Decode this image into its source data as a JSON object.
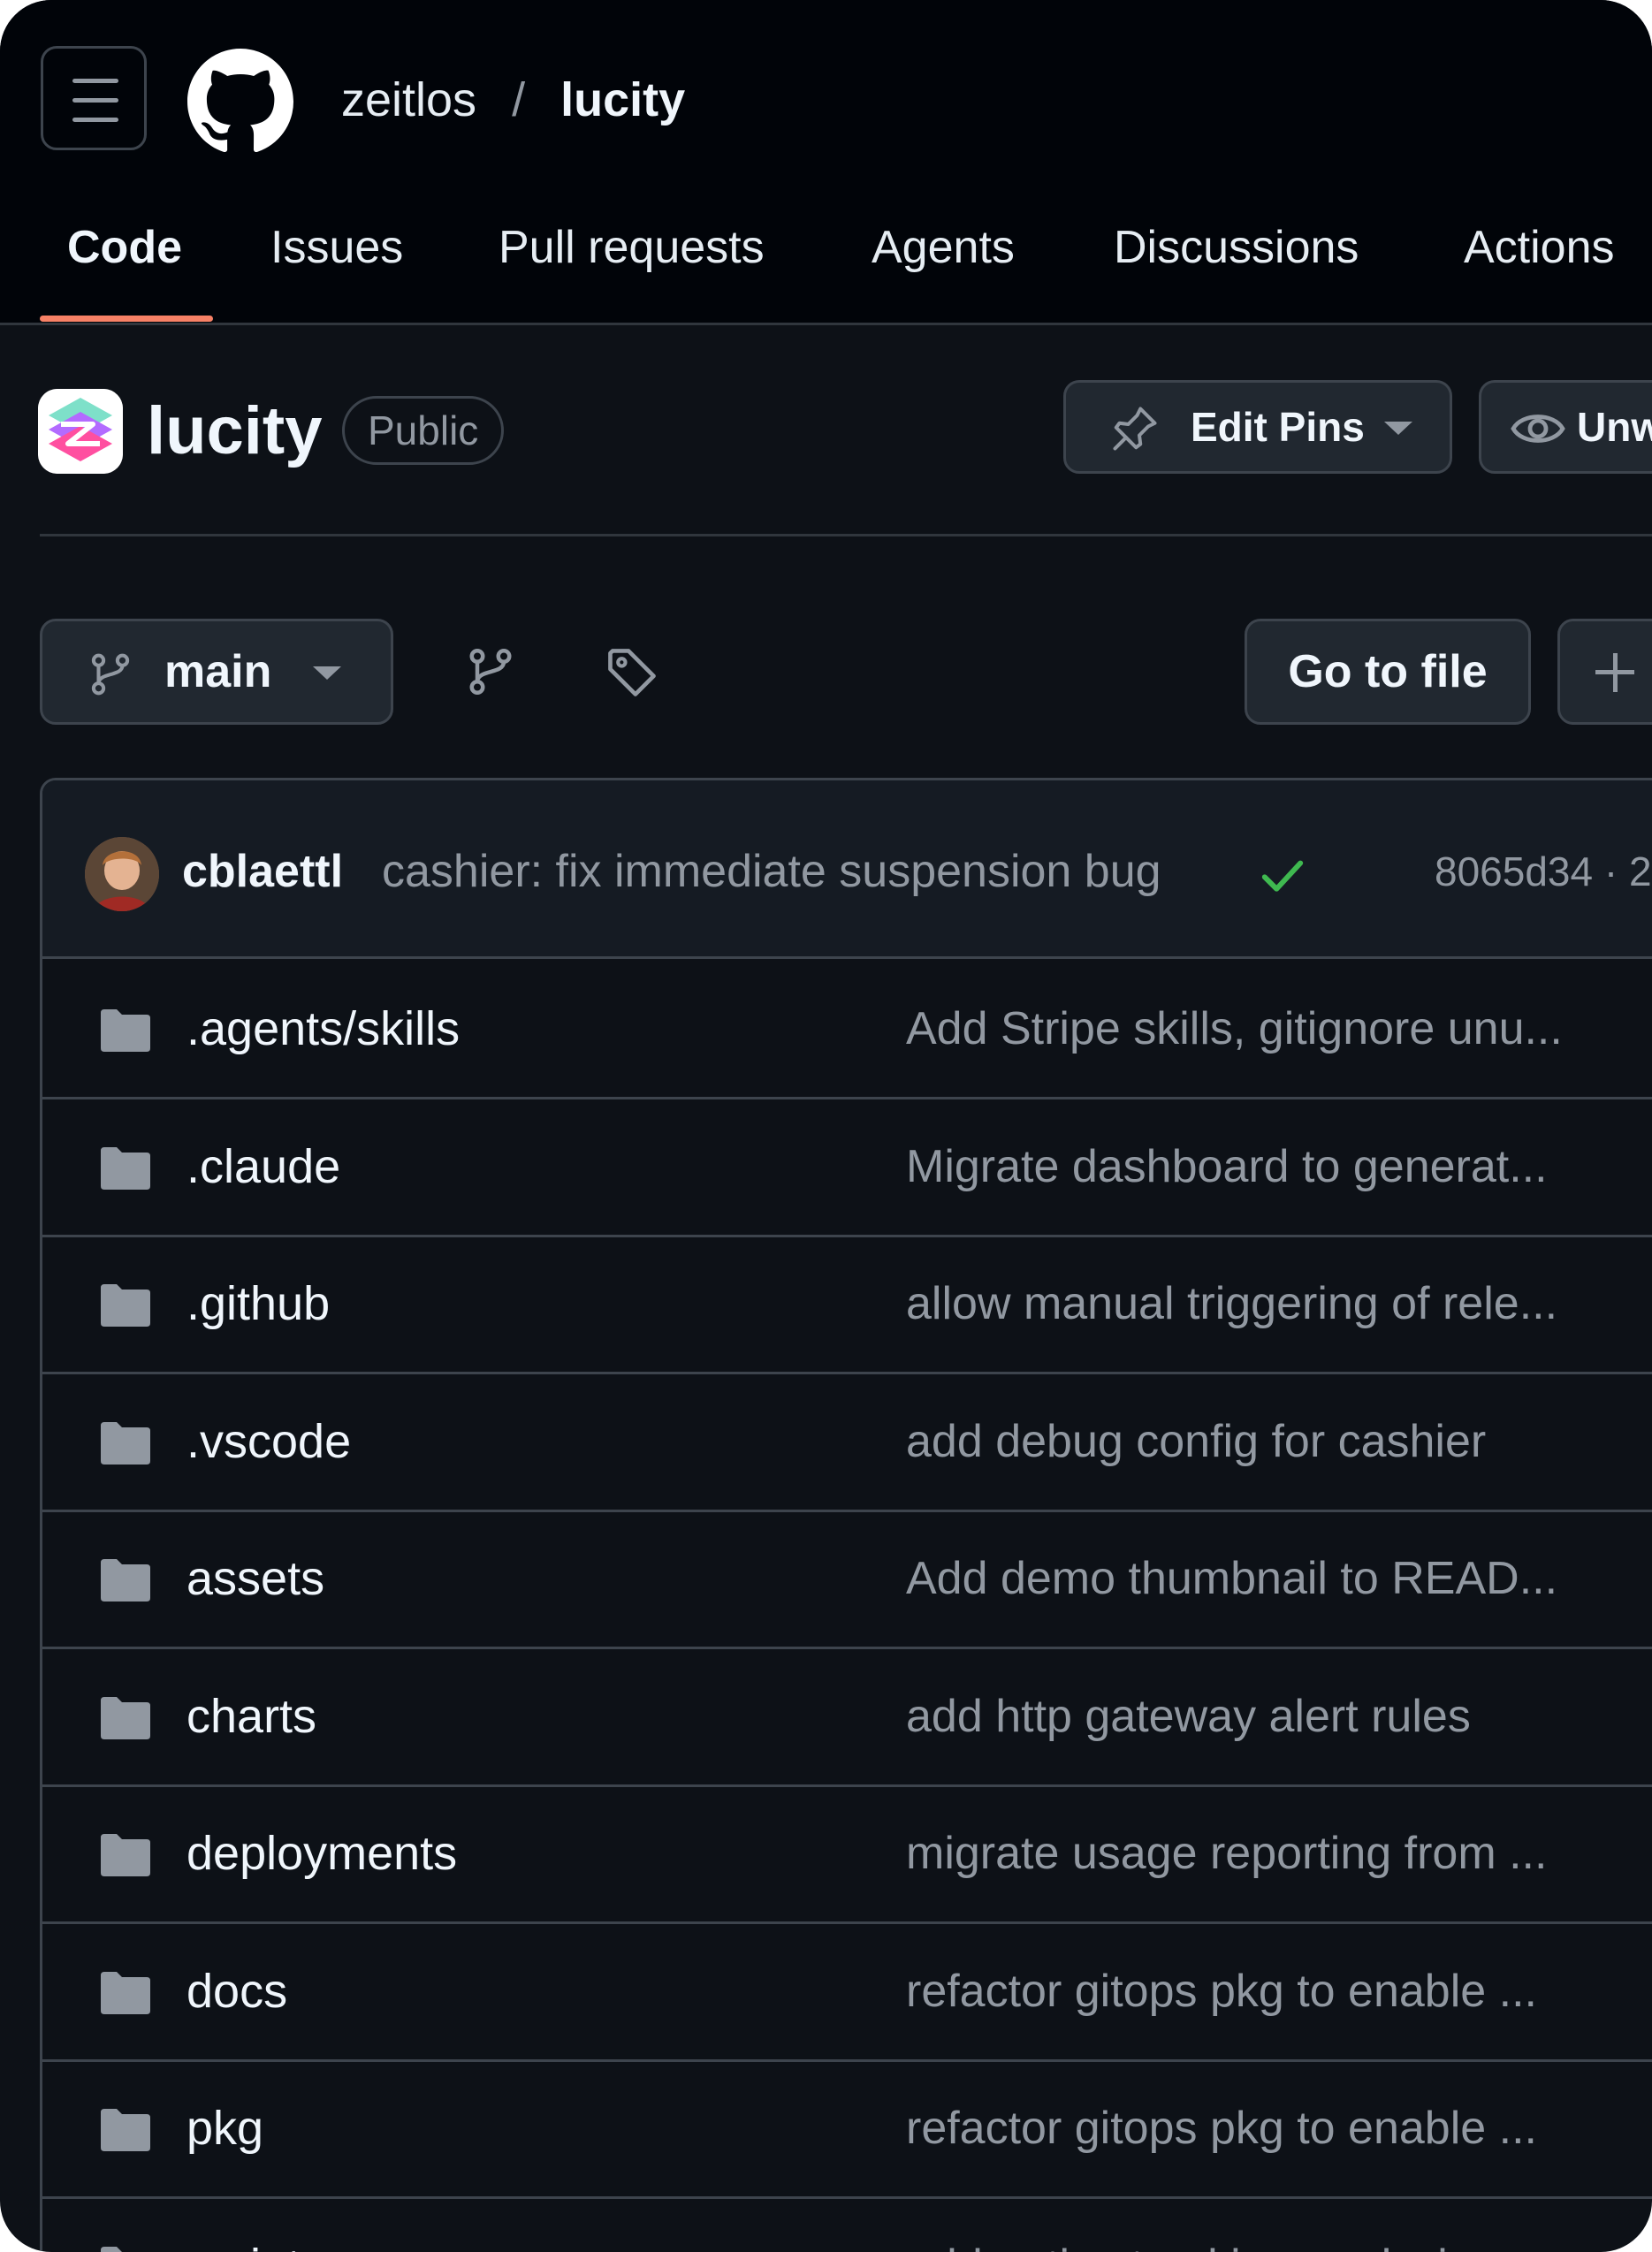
{
  "header": {
    "owner": "zeitlos",
    "separator": "/",
    "repo": "lucity",
    "menu_icon": "hamburger-icon",
    "logo_icon": "github-mark-icon"
  },
  "tabs": [
    {
      "label": "Code",
      "active": true
    },
    {
      "label": "Issues",
      "active": false
    },
    {
      "label": "Pull requests",
      "active": false
    },
    {
      "label": "Agents",
      "active": false
    },
    {
      "label": "Discussions",
      "active": false
    },
    {
      "label": "Actions",
      "active": false
    }
  ],
  "repo": {
    "name": "lucity",
    "visibility": "Public",
    "edit_pins_label": "Edit Pins",
    "watch_label": "Unwatch"
  },
  "branch_bar": {
    "branch": "main",
    "goto_file_label": "Go to file"
  },
  "latest_commit": {
    "author": "cblaettl",
    "message": "cashier: fix immediate suspension bug",
    "status": "success",
    "sha": "8065d34 · 2"
  },
  "files": [
    {
      "name": ".agents/skills",
      "type": "folder",
      "commit": "Add Stripe skills, gitignore unu..."
    },
    {
      "name": ".claude",
      "type": "folder",
      "commit": "Migrate dashboard to generat..."
    },
    {
      "name": ".github",
      "type": "folder",
      "commit": "allow manual triggering of rele..."
    },
    {
      "name": ".vscode",
      "type": "folder",
      "commit": "add debug config for cashier"
    },
    {
      "name": "assets",
      "type": "folder",
      "commit": "Add demo thumbnail to READ..."
    },
    {
      "name": "charts",
      "type": "folder",
      "commit": "add http gateway alert rules"
    },
    {
      "name": "deployments",
      "type": "folder",
      "commit": "migrate usage reporting from ..."
    },
    {
      "name": "docs",
      "type": "folder",
      "commit": "refactor gitops pkg to enable ..."
    },
    {
      "name": "pkg",
      "type": "folder",
      "commit": "refactor gitops pkg to enable ..."
    },
    {
      "name": "scripts",
      "type": "folder",
      "commit": "add native tracking analysis..."
    }
  ],
  "colors": {
    "background": "#0d1117",
    "header_bg": "#010409",
    "active_tab_underline": "#f78166",
    "success_check": "#3fb950",
    "muted_text": "#9198a1",
    "border": "#3d444d"
  }
}
